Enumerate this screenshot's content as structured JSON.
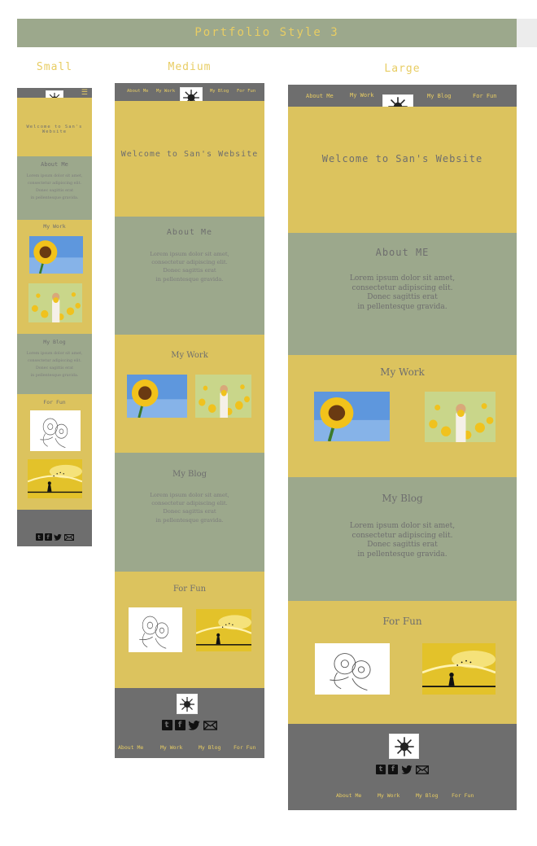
{
  "title": "Portfolio Style 3",
  "columns": {
    "small": "Small",
    "medium": "Medium",
    "large": "Large"
  },
  "nav": {
    "about": "About Me",
    "work": "My Work",
    "blog": "My Blog",
    "fun": "For Fun"
  },
  "menu_icon": "hamburger-menu-icon",
  "hero": {
    "welcome": "Welcome to San's Website"
  },
  "about": {
    "title_sm": "About Me",
    "title_lg": "About ME"
  },
  "work": {
    "title": "My Work"
  },
  "blog": {
    "title": "My Blog"
  },
  "fun": {
    "title": "For Fun"
  },
  "lorem": {
    "line1": "Lorem ipsum dolor sit amet,",
    "line2": "consectetur adipiscing elit.",
    "line3": "Donec sagittis erat",
    "line4": "in pellentesque gravida."
  },
  "footer": {
    "social": {
      "tumblr": "t",
      "facebook": "f"
    },
    "icons": [
      "tumblr-icon",
      "facebook-icon",
      "twitter-icon",
      "mail-icon"
    ]
  },
  "colors": {
    "yellow": "#dcc35e",
    "sage": "#9ca88c",
    "grey": "#6e6e6e",
    "accent_text": "#e8cd63"
  }
}
